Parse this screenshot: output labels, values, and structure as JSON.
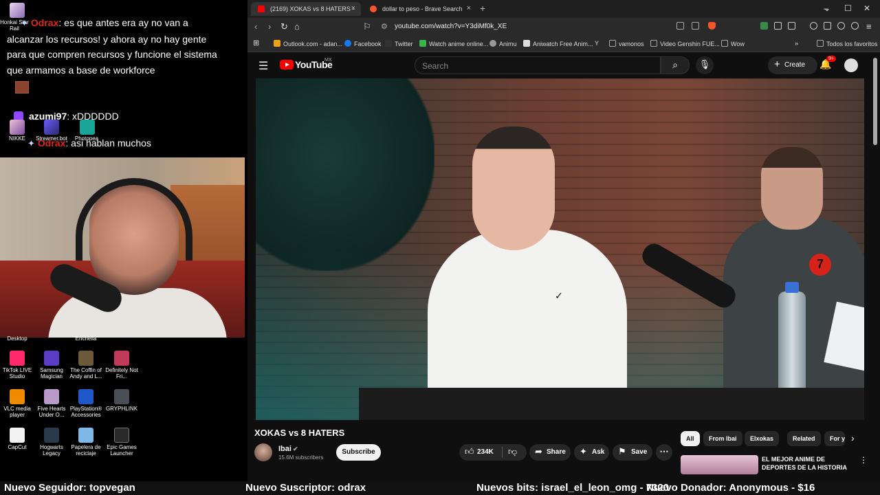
{
  "stream": {
    "chat": [
      {
        "user": "Odrax",
        "text": ": es que antes era ay no van a alcanzar los recursos! y ahora ay no hay gente para que compren recursos y funcione el sistema que armamos a base de workforce"
      },
      {
        "user": "azumi97",
        "text": ": xDDDDDD"
      },
      {
        "user": "Odrax",
        "text": ": asi hablan muchos"
      }
    ],
    "overlay_labels": {
      "honkai": "Honkai Star Rail",
      "nikke": "NIKKE",
      "streamerbot": "Streamer.bot",
      "photopea": "Photopea",
      "desktop": "Desktop",
      "enchelia": "Enchelia"
    }
  },
  "desktop_icons": [
    {
      "label": "TikTok LIVE Studio",
      "color": "#ff2a6a"
    },
    {
      "label": "Samsung Magician",
      "color": "#5b3cc4"
    },
    {
      "label": "The Coffin of Andy and L...",
      "color": "#6a5a3a"
    },
    {
      "label": "Definitely Not Fri...",
      "color": "#c23a5a"
    },
    {
      "label": "VLC media player",
      "color": "#f08a00"
    },
    {
      "label": "Five Hearts Under O...",
      "color": "#b79ac7"
    },
    {
      "label": "PlayStation® Accessories",
      "color": "#1f58c9"
    },
    {
      "label": "GRYPHLINK",
      "color": "#4a4f57"
    },
    {
      "label": "CapCut",
      "color": "#f2f2f2"
    },
    {
      "label": "Hogwarts Legacy",
      "color": "#2b3a4a"
    },
    {
      "label": "Papelera de reciclaje",
      "color": "#7fb8e6"
    },
    {
      "label": "Epic Games Launcher",
      "color": "#2a2a2a"
    }
  ],
  "browser": {
    "tabs": [
      {
        "title": "(2169) XOKAS vs 8 HATERS -",
        "color": "#ff0000"
      },
      {
        "title": "dollar to peso - Brave Search",
        "color": "#fb542b"
      }
    ],
    "url": "youtube.com/watch?v=Y3diMf0k_XE",
    "bookmarks": [
      {
        "label": "Outlook.com - adan...",
        "color": "#e8a317"
      },
      {
        "label": "Facebook",
        "color": "#1877f2"
      },
      {
        "label": "Twitter",
        "color": "#333333"
      },
      {
        "label": "Watch anime online...",
        "color": "#3ab54a"
      },
      {
        "label": "Animu",
        "color": "#999999"
      },
      {
        "label": "Aniwatch Free Anim...",
        "color": "#dddddd"
      },
      {
        "label": "vamonos",
        "color": "#aaaaaa"
      },
      {
        "label": "Video Genshin FUE...",
        "color": "#aaaaaa"
      },
      {
        "label": "Wow",
        "color": "#aaaaaa"
      },
      {
        "label": "Todos los favoritos",
        "color": "#aaaaaa"
      }
    ]
  },
  "youtube": {
    "logo_text": "YouTube",
    "region": "MX",
    "search_placeholder": "Search",
    "create_label": "Create",
    "notifications": "9+",
    "video_title": "XOKAS vs 8 HATERS",
    "video_tag_number": "7",
    "channel_name": "Ibai",
    "channel_subs": "15.6M subscribers",
    "subscribe_label": "Subscribe",
    "likes": "234K",
    "share_label": "Share",
    "ask_label": "Ask",
    "save_label": "Save",
    "chips": [
      "All",
      "From Ibai",
      "Elxokas",
      "Related",
      "For yo"
    ],
    "recommended_title": "EL MEJOR ANIME DE DEPORTES DE LA HISTORIA"
  },
  "ticker": {
    "follower": "Nuevo Seguidor: topvegan",
    "subscriber": "Nuevo Suscriptor: odrax",
    "bits": "Nuevos bits: israel_el_leon_omg - 7320",
    "donor": "Nuevo Donador: Anonymous - $16"
  }
}
